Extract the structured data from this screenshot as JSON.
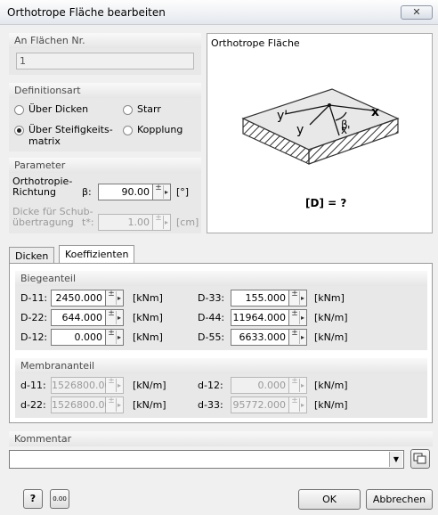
{
  "window": {
    "title": "Orthotrope Fläche bearbeiten",
    "close_glyph": "✕"
  },
  "surface_no": {
    "label": "An Flächen Nr.",
    "value": "1"
  },
  "definition": {
    "label": "Definitionsart",
    "opt_thickness": "Über Dicken",
    "opt_rigid": "Starr",
    "opt_stiffness_1": "Über Steifigkeits-",
    "opt_stiffness_2": "matrix",
    "opt_coupling": "Kopplung",
    "selected": "stiffness"
  },
  "parameter": {
    "label": "Parameter",
    "dir_1": "Orthotropie-",
    "dir_2": "Richtung",
    "beta_symbol": "β:",
    "beta_value": "90.00",
    "beta_unit": "[°]",
    "shear_1": "Dicke für Schub-",
    "shear_2": "übertragung",
    "shear_symbol": "t*:",
    "shear_value": "1.00",
    "shear_unit": "[cm]"
  },
  "image": {
    "title": "Orthotrope Fläche",
    "caption": "[D] = ?",
    "labels": {
      "y_prime": "y'",
      "y": "y",
      "x_prime": "x'",
      "x": "x",
      "beta": "β"
    }
  },
  "tabs": [
    "Dicken",
    "Koeffizienten"
  ],
  "bending": {
    "label": "Biegeanteil",
    "rows": [
      {
        "l1": "D-11:",
        "v1": "2450.000",
        "u1": "[kNm]",
        "l2": "D-33:",
        "v2": "155.000",
        "u2": "[kNm]"
      },
      {
        "l1": "D-22:",
        "v1": "644.000",
        "u1": "[kNm]",
        "l2": "D-44:",
        "v2": "11964.000",
        "u2": "[kN/m]"
      },
      {
        "l1": "D-12:",
        "v1": "0.000",
        "u1": "[kNm]",
        "l2": "D-55:",
        "v2": "6633.000",
        "u2": "[kN/m]"
      }
    ]
  },
  "membrane": {
    "label": "Membrananteil",
    "rows": [
      {
        "l1": "d-11:",
        "v1": "1526800.00",
        "u1": "[kN/m]",
        "l2": "d-12:",
        "v2": "0.000",
        "u2": "[kN/m]"
      },
      {
        "l1": "d-22:",
        "v1": "1526800.00",
        "u1": "[kN/m]",
        "l2": "d-33:",
        "v2": "95772.000",
        "u2": "[kN/m]"
      }
    ]
  },
  "comment": {
    "label": "Kommentar",
    "value": ""
  },
  "buttons": {
    "help": "?",
    "units": "0.00",
    "ok": "OK",
    "cancel": "Abbrechen"
  },
  "spin_glyphs": {
    "pm": "+\n−",
    "arrow": "▸"
  }
}
